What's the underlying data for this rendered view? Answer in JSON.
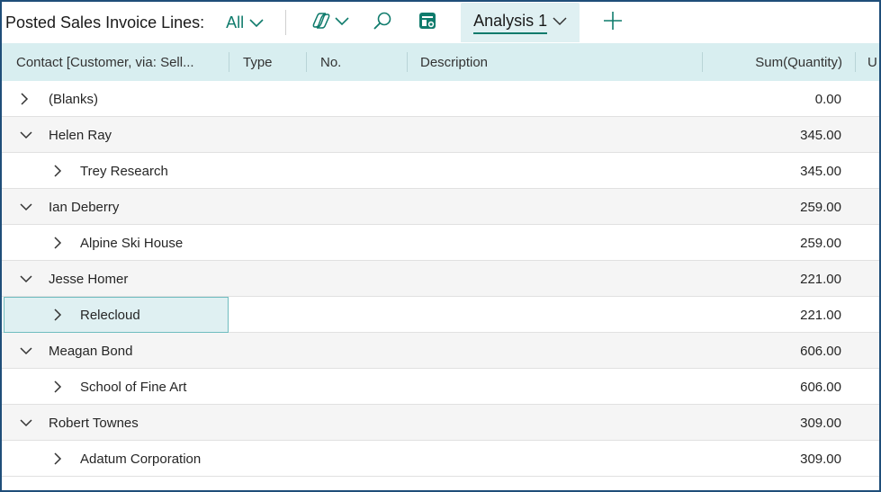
{
  "toolbar": {
    "title": "Posted Sales Invoice Lines:",
    "view_filter": "All",
    "tab_label": "Analysis 1"
  },
  "columns": {
    "contact": "Contact [Customer, via: Sell...",
    "type": "Type",
    "no": "No.",
    "description": "Description",
    "sum_quantity": "Sum(Quantity)",
    "cut_off": "U"
  },
  "rows": [
    {
      "level": 0,
      "expanded": false,
      "name": "(Blanks)",
      "qty": "0.00"
    },
    {
      "level": 0,
      "expanded": true,
      "name": "Helen Ray",
      "qty": "345.00"
    },
    {
      "level": 1,
      "expanded": false,
      "name": "Trey Research",
      "qty": "345.00"
    },
    {
      "level": 0,
      "expanded": true,
      "name": "Ian Deberry",
      "qty": "259.00"
    },
    {
      "level": 1,
      "expanded": false,
      "name": "Alpine Ski House",
      "qty": "259.00"
    },
    {
      "level": 0,
      "expanded": true,
      "name": "Jesse Homer",
      "qty": "221.00"
    },
    {
      "level": 1,
      "expanded": false,
      "name": "Relecloud",
      "qty": "221.00",
      "selected": true
    },
    {
      "level": 0,
      "expanded": true,
      "name": "Meagan Bond",
      "qty": "606.00"
    },
    {
      "level": 1,
      "expanded": false,
      "name": "School of Fine Art",
      "qty": "606.00"
    },
    {
      "level": 0,
      "expanded": true,
      "name": "Robert Townes",
      "qty": "309.00"
    },
    {
      "level": 1,
      "expanded": false,
      "name": "Adatum Corporation",
      "qty": "309.00"
    }
  ],
  "colors": {
    "accent": "#0f7b6c",
    "header_bg": "#d8eef0",
    "frame_border": "#1f4e79",
    "selected_border": "#6fbcbf"
  },
  "icons": {
    "view_dropdown": "chevron-down-icon",
    "copilot": "copilot-icon",
    "search": "search-icon",
    "analysis": "analysis-icon",
    "add_tab": "plus-icon",
    "expand": "chevron-right-icon",
    "collapse": "chevron-down-icon"
  }
}
